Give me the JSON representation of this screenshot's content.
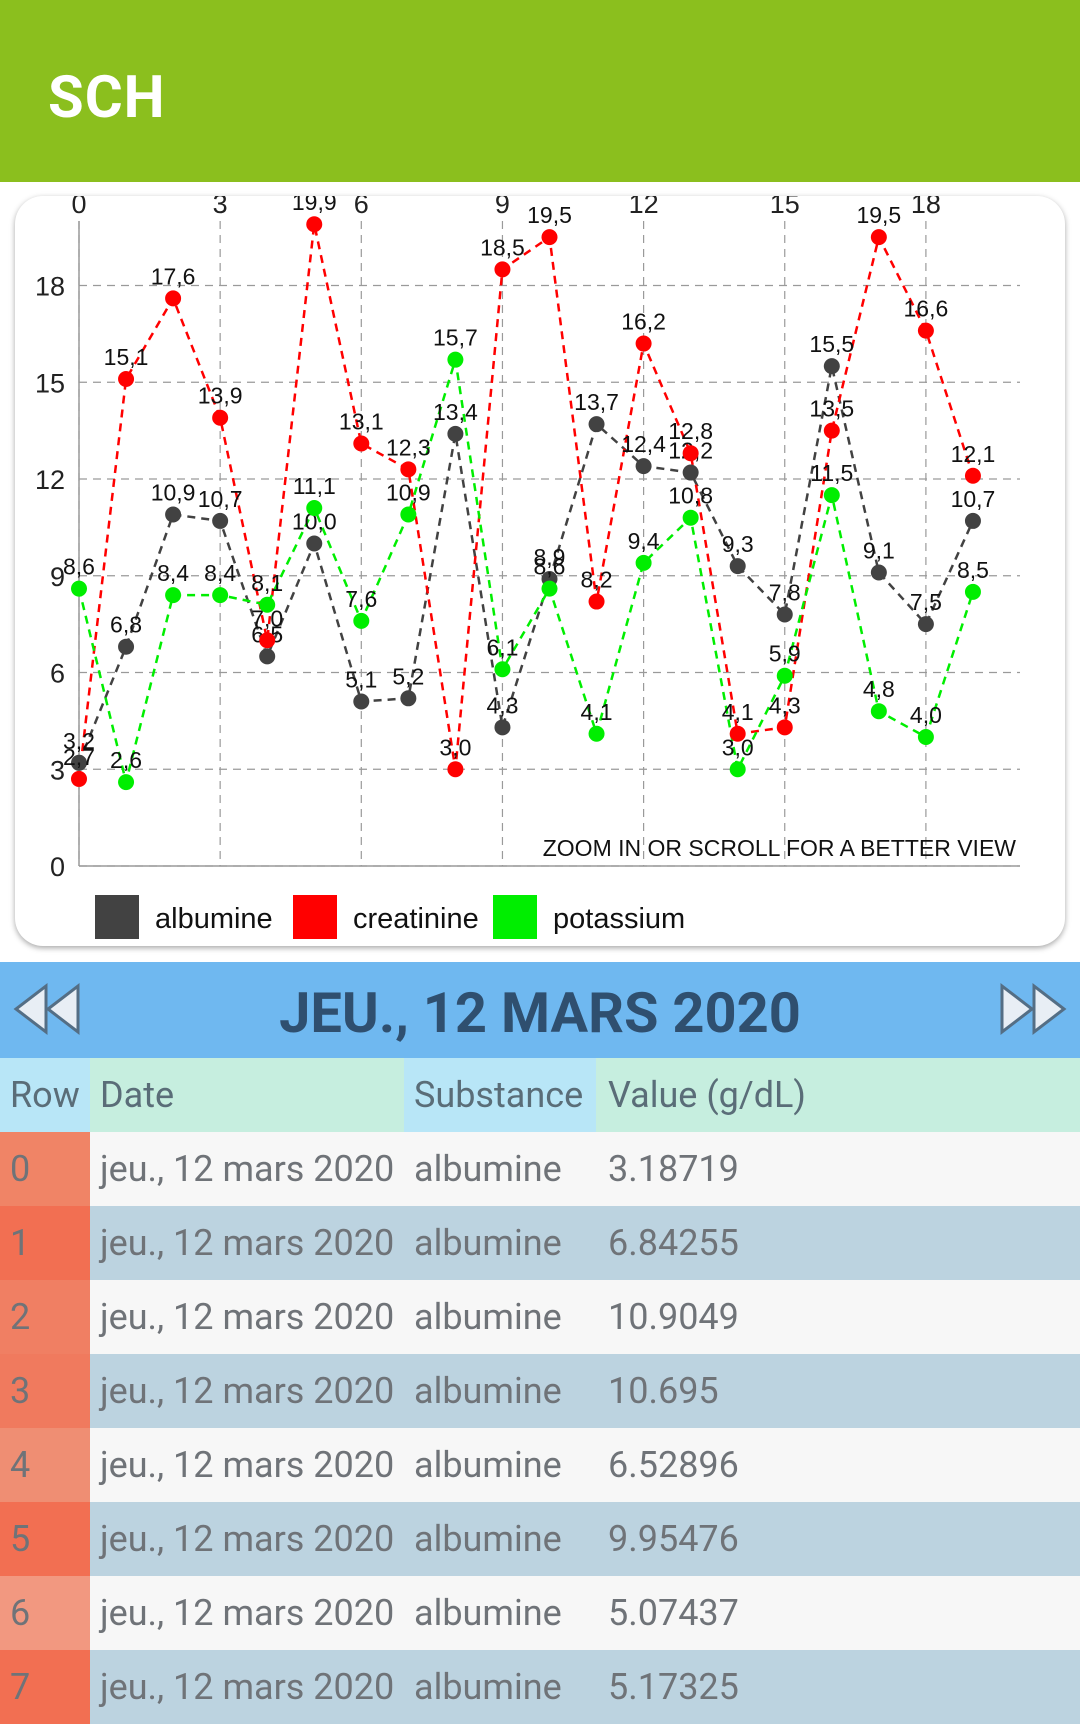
{
  "app": {
    "title": "SCH"
  },
  "chart_data": {
    "type": "line",
    "x": [
      0,
      1,
      2,
      3,
      4,
      5,
      6,
      7,
      8,
      9,
      10,
      11,
      12,
      13,
      14,
      15,
      16,
      17,
      18,
      19
    ],
    "x_ticks": [
      "0",
      "3",
      "6",
      "9",
      "12",
      "15",
      "18"
    ],
    "y_ticks": [
      "0",
      "3",
      "6",
      "9",
      "12",
      "15",
      "18"
    ],
    "xlim": [
      0,
      20
    ],
    "ylim": [
      0,
      20
    ],
    "grid": true,
    "legend_position": "bottom",
    "hint": "ZOOM IN OR SCROLL FOR A BETTER VIEW",
    "series": [
      {
        "name": "albumine",
        "color": "#424242",
        "values": [
          3.2,
          6.8,
          10.9,
          10.7,
          6.5,
          10.0,
          5.1,
          5.2,
          13.4,
          4.3,
          8.9,
          13.7,
          12.4,
          12.2,
          9.3,
          7.8,
          15.5,
          9.1,
          7.5,
          10.7
        ],
        "labels": [
          "3,2",
          "6,8",
          "10,9",
          "10,7",
          "6,5",
          "10,0",
          "5,1",
          "5,2",
          "13,4",
          "4,3",
          "8,9",
          "13,7",
          "12,4",
          "12,2",
          "9,3",
          "7,8",
          "15,5",
          "9,1",
          "7,5",
          "10,7"
        ]
      },
      {
        "name": "creatinine",
        "color": "#ff0000",
        "values": [
          2.7,
          15.1,
          17.6,
          13.9,
          7.0,
          19.9,
          13.1,
          12.3,
          3.0,
          18.5,
          19.5,
          8.2,
          16.2,
          12.8,
          4.1,
          4.3,
          13.5,
          19.5,
          16.6,
          12.1
        ],
        "labels": [
          "2,7",
          "15,1",
          "17,6",
          "13,9",
          "7,0",
          "19,9",
          "13,1",
          "12,3",
          "3,0",
          "18,5",
          "19,5",
          "8,2",
          "16,2",
          "12,8",
          "4,1",
          "4,3",
          "13,5",
          "19,5",
          "16,6",
          "12,1"
        ]
      },
      {
        "name": "potassium",
        "color": "#00ee00",
        "values": [
          8.6,
          2.6,
          8.4,
          8.4,
          8.1,
          11.1,
          7.6,
          10.9,
          15.7,
          6.1,
          8.6,
          4.1,
          9.4,
          10.8,
          3.0,
          5.9,
          11.5,
          4.8,
          4.0,
          8.5
        ],
        "labels": [
          "8,6",
          "2,6",
          "8,4",
          "8,4",
          "8,1",
          "11,1",
          "7,6",
          "10,9",
          "15,7",
          "6,1",
          "8,6",
          "4,1",
          "9,4",
          "10,8",
          "3,0",
          "5,9",
          "11,5",
          "4,8",
          "4,0",
          "8,5"
        ]
      }
    ]
  },
  "date_nav": {
    "label": "JEU., 12 MARS 2020",
    "prev_icon": "rewind-icon",
    "next_icon": "fast-forward-icon"
  },
  "table": {
    "headers": [
      "Row",
      "Date",
      "Substance",
      "Value (g/dL)"
    ],
    "rows": [
      [
        "0",
        "jeu., 12 mars 2020",
        "albumine",
        "3.18719"
      ],
      [
        "1",
        "jeu., 12 mars 2020",
        "albumine",
        "6.84255"
      ],
      [
        "2",
        "jeu., 12 mars 2020",
        "albumine",
        "10.9049"
      ],
      [
        "3",
        "jeu., 12 mars 2020",
        "albumine",
        "10.695"
      ],
      [
        "4",
        "jeu., 12 mars 2020",
        "albumine",
        "6.52896"
      ],
      [
        "5",
        "jeu., 12 mars 2020",
        "albumine",
        "9.95476"
      ],
      [
        "6",
        "jeu., 12 mars 2020",
        "albumine",
        "5.07437"
      ],
      [
        "7",
        "jeu., 12 mars 2020",
        "albumine",
        "5.17325"
      ]
    ],
    "row_colors": [
      "#f08466",
      "#f26f52",
      "#f07f63",
      "#f07a5e",
      "#ef8e73",
      "#f26f52",
      "#f29880",
      "#f26f52"
    ]
  }
}
